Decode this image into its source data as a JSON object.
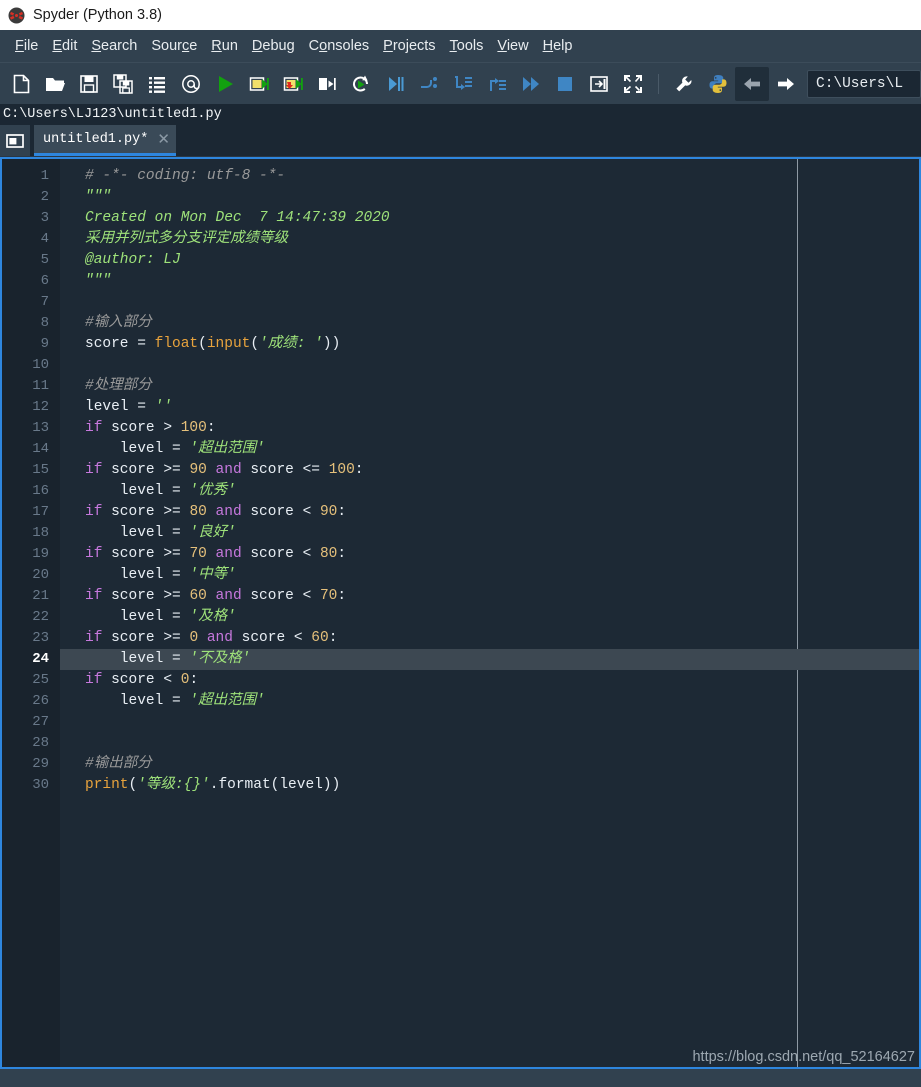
{
  "window": {
    "title": "Spyder (Python 3.8)",
    "app_icon": "spyder-logo-icon"
  },
  "menubar": {
    "items": [
      {
        "label": "File",
        "mnemonic": "F",
        "name": "menu-file"
      },
      {
        "label": "Edit",
        "mnemonic": "E",
        "name": "menu-edit"
      },
      {
        "label": "Search",
        "mnemonic": "S",
        "name": "menu-search"
      },
      {
        "label": "Source",
        "mnemonic": "c",
        "name": "menu-source"
      },
      {
        "label": "Run",
        "mnemonic": "R",
        "name": "menu-run"
      },
      {
        "label": "Debug",
        "mnemonic": "D",
        "name": "menu-debug"
      },
      {
        "label": "Consoles",
        "mnemonic": "o",
        "name": "menu-consoles"
      },
      {
        "label": "Projects",
        "mnemonic": "P",
        "name": "menu-projects"
      },
      {
        "label": "Tools",
        "mnemonic": "T",
        "name": "menu-tools"
      },
      {
        "label": "View",
        "mnemonic": "V",
        "name": "menu-view"
      },
      {
        "label": "Help",
        "mnemonic": "H",
        "name": "menu-help"
      }
    ]
  },
  "toolbar": {
    "icons": [
      "new-file-icon",
      "open-file-icon",
      "save-file-icon",
      "save-all-icon",
      "file-list-icon",
      "at-sign-icon",
      "run-file-icon",
      "run-cell-icon",
      "run-cell-advance-icon",
      "run-selection-icon",
      "rerun-cell-icon",
      "debug-file-icon",
      "debug-step-over-icon",
      "debug-step-into-icon",
      "debug-step-return-icon",
      "debug-continue-icon",
      "debug-stop-icon",
      "maximize-pane-icon",
      "fullscreen-icon",
      "preferences-icon",
      "pythonpath-manager-icon",
      "back-arrow-icon",
      "forward-arrow-icon"
    ],
    "path_value": "C:\\Users\\L"
  },
  "pathstrip": {
    "path": "C:\\Users\\LJ123\\untitled1.py"
  },
  "tabbar": {
    "browse_icon": "browse-tabs-icon",
    "tabs": [
      {
        "label": "untitled1.py*",
        "close_glyph": "✕",
        "modified": true
      }
    ]
  },
  "editor": {
    "current_line": 24,
    "total_lines": 30,
    "line_numbers": [
      1,
      2,
      3,
      4,
      5,
      6,
      7,
      8,
      9,
      10,
      11,
      12,
      13,
      14,
      15,
      16,
      17,
      18,
      19,
      20,
      21,
      22,
      23,
      24,
      25,
      26,
      27,
      28,
      29,
      30
    ],
    "colors": {
      "background": "#1d2935",
      "gutter": "#19232d",
      "current_line_highlight": "#3d4852",
      "comment": "#999999",
      "string": "#9ee27a",
      "keyword": "#c678dd",
      "builtin": "#e8a33d",
      "number": "#e5c07b",
      "text": "#e8eef4",
      "border": "#2e86de"
    },
    "lines": [
      {
        "n": 1,
        "tokens": [
          {
            "t": "com",
            "v": "# -*- coding: utf-8 -*-"
          }
        ]
      },
      {
        "n": 2,
        "tokens": [
          {
            "t": "docs",
            "v": "\"\"\""
          }
        ]
      },
      {
        "n": 3,
        "tokens": [
          {
            "t": "docs",
            "v": "Created on Mon Dec  7 14:47:39 2020"
          }
        ]
      },
      {
        "n": 4,
        "tokens": [
          {
            "t": "docs",
            "v": "采用并列式多分支评定成绩等级"
          }
        ]
      },
      {
        "n": 5,
        "tokens": [
          {
            "t": "docs",
            "v": "@author: LJ"
          }
        ]
      },
      {
        "n": 6,
        "tokens": [
          {
            "t": "docs",
            "v": "\"\"\""
          }
        ]
      },
      {
        "n": 7,
        "tokens": []
      },
      {
        "n": 8,
        "tokens": [
          {
            "t": "com",
            "v": "#输入部分"
          }
        ]
      },
      {
        "n": 9,
        "tokens": [
          {
            "t": "plain",
            "v": "score "
          },
          {
            "t": "op",
            "v": "= "
          },
          {
            "t": "bi",
            "v": "float"
          },
          {
            "t": "op",
            "v": "("
          },
          {
            "t": "bi",
            "v": "input"
          },
          {
            "t": "op",
            "v": "("
          },
          {
            "t": "str",
            "v": "'成绩: '"
          },
          {
            "t": "op",
            "v": "))"
          }
        ]
      },
      {
        "n": 10,
        "tokens": []
      },
      {
        "n": 11,
        "tokens": [
          {
            "t": "com",
            "v": "#处理部分"
          }
        ]
      },
      {
        "n": 12,
        "tokens": [
          {
            "t": "plain",
            "v": "level "
          },
          {
            "t": "op",
            "v": "= "
          },
          {
            "t": "str",
            "v": "''"
          }
        ]
      },
      {
        "n": 13,
        "tokens": [
          {
            "t": "kw",
            "v": "if "
          },
          {
            "t": "plain",
            "v": "score "
          },
          {
            "t": "op",
            "v": "> "
          },
          {
            "t": "num",
            "v": "100"
          },
          {
            "t": "op",
            "v": ":"
          }
        ]
      },
      {
        "n": 14,
        "tokens": [
          {
            "t": "plain",
            "v": "    level "
          },
          {
            "t": "op",
            "v": "= "
          },
          {
            "t": "str",
            "v": "'超出范围'"
          }
        ]
      },
      {
        "n": 15,
        "tokens": [
          {
            "t": "kw",
            "v": "if "
          },
          {
            "t": "plain",
            "v": "score "
          },
          {
            "t": "op",
            "v": ">= "
          },
          {
            "t": "num",
            "v": "90 "
          },
          {
            "t": "kw",
            "v": "and "
          },
          {
            "t": "plain",
            "v": "score "
          },
          {
            "t": "op",
            "v": "<= "
          },
          {
            "t": "num",
            "v": "100"
          },
          {
            "t": "op",
            "v": ":"
          }
        ]
      },
      {
        "n": 16,
        "tokens": [
          {
            "t": "plain",
            "v": "    level "
          },
          {
            "t": "op",
            "v": "= "
          },
          {
            "t": "str",
            "v": "'优秀'"
          }
        ]
      },
      {
        "n": 17,
        "tokens": [
          {
            "t": "kw",
            "v": "if "
          },
          {
            "t": "plain",
            "v": "score "
          },
          {
            "t": "op",
            "v": ">= "
          },
          {
            "t": "num",
            "v": "80 "
          },
          {
            "t": "kw",
            "v": "and "
          },
          {
            "t": "plain",
            "v": "score "
          },
          {
            "t": "op",
            "v": "< "
          },
          {
            "t": "num",
            "v": "90"
          },
          {
            "t": "op",
            "v": ":"
          }
        ]
      },
      {
        "n": 18,
        "tokens": [
          {
            "t": "plain",
            "v": "    level "
          },
          {
            "t": "op",
            "v": "= "
          },
          {
            "t": "str",
            "v": "'良好'"
          }
        ]
      },
      {
        "n": 19,
        "tokens": [
          {
            "t": "kw",
            "v": "if "
          },
          {
            "t": "plain",
            "v": "score "
          },
          {
            "t": "op",
            "v": ">= "
          },
          {
            "t": "num",
            "v": "70 "
          },
          {
            "t": "kw",
            "v": "and "
          },
          {
            "t": "plain",
            "v": "score "
          },
          {
            "t": "op",
            "v": "< "
          },
          {
            "t": "num",
            "v": "80"
          },
          {
            "t": "op",
            "v": ":"
          }
        ]
      },
      {
        "n": 20,
        "tokens": [
          {
            "t": "plain",
            "v": "    level "
          },
          {
            "t": "op",
            "v": "= "
          },
          {
            "t": "str",
            "v": "'中等'"
          }
        ]
      },
      {
        "n": 21,
        "tokens": [
          {
            "t": "kw",
            "v": "if "
          },
          {
            "t": "plain",
            "v": "score "
          },
          {
            "t": "op",
            "v": ">= "
          },
          {
            "t": "num",
            "v": "60 "
          },
          {
            "t": "kw",
            "v": "and "
          },
          {
            "t": "plain",
            "v": "score "
          },
          {
            "t": "op",
            "v": "< "
          },
          {
            "t": "num",
            "v": "70"
          },
          {
            "t": "op",
            "v": ":"
          }
        ]
      },
      {
        "n": 22,
        "tokens": [
          {
            "t": "plain",
            "v": "    level "
          },
          {
            "t": "op",
            "v": "= "
          },
          {
            "t": "str",
            "v": "'及格'"
          }
        ]
      },
      {
        "n": 23,
        "tokens": [
          {
            "t": "kw",
            "v": "if "
          },
          {
            "t": "plain",
            "v": "score "
          },
          {
            "t": "op",
            "v": ">= "
          },
          {
            "t": "num",
            "v": "0 "
          },
          {
            "t": "kw",
            "v": "and "
          },
          {
            "t": "plain",
            "v": "score "
          },
          {
            "t": "op",
            "v": "< "
          },
          {
            "t": "num",
            "v": "60"
          },
          {
            "t": "op",
            "v": ":"
          }
        ]
      },
      {
        "n": 24,
        "tokens": [
          {
            "t": "plain",
            "v": "    level "
          },
          {
            "t": "op",
            "v": "= "
          },
          {
            "t": "str",
            "v": "'不及格'"
          }
        ],
        "highlight": true
      },
      {
        "n": 25,
        "tokens": [
          {
            "t": "kw",
            "v": "if "
          },
          {
            "t": "plain",
            "v": "score "
          },
          {
            "t": "op",
            "v": "< "
          },
          {
            "t": "num",
            "v": "0"
          },
          {
            "t": "op",
            "v": ":"
          }
        ]
      },
      {
        "n": 26,
        "tokens": [
          {
            "t": "plain",
            "v": "    level "
          },
          {
            "t": "op",
            "v": "= "
          },
          {
            "t": "str",
            "v": "'超出范围'"
          }
        ]
      },
      {
        "n": 27,
        "tokens": []
      },
      {
        "n": 28,
        "tokens": []
      },
      {
        "n": 29,
        "tokens": [
          {
            "t": "com",
            "v": "#输出部分"
          }
        ]
      },
      {
        "n": 30,
        "tokens": [
          {
            "t": "bi",
            "v": "print"
          },
          {
            "t": "op",
            "v": "("
          },
          {
            "t": "str",
            "v": "'等级:{}'"
          },
          {
            "t": "op",
            "v": "."
          },
          {
            "t": "plain",
            "v": "format"
          },
          {
            "t": "op",
            "v": "(level))"
          }
        ]
      }
    ]
  },
  "watermark": {
    "text": "https://blog.csdn.net/qq_52164627"
  }
}
